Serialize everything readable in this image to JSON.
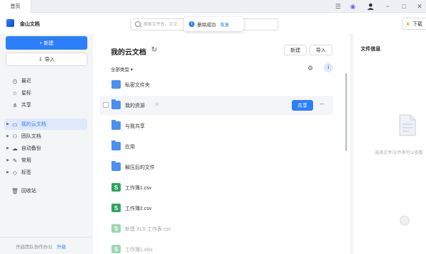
{
  "titlebar": {
    "home_tab": "首页"
  },
  "header": {
    "app_name": "金山文档",
    "search_placeholder": "搜索文件名、正文",
    "toast_text": "删除成功",
    "toast_action": "恢复",
    "right_button_label": "下载"
  },
  "sidebar": {
    "new_label": "+ 新建",
    "import_label": "导入",
    "items": [
      {
        "label": "最近",
        "icon": "clock-icon"
      },
      {
        "label": "星标",
        "icon": "star-icon"
      },
      {
        "label": "共享",
        "icon": "share-icon"
      },
      {
        "label": "我的云文档",
        "icon": "folder-icon"
      },
      {
        "label": "团队文档",
        "icon": "team-icon"
      },
      {
        "label": "自动备份",
        "icon": "backup-icon"
      },
      {
        "label": "常用",
        "icon": "pin-icon"
      },
      {
        "label": "标签",
        "icon": "tag-icon"
      },
      {
        "label": "回收站",
        "icon": "trash-icon"
      }
    ],
    "footer_text": "开启团队协作办公",
    "footer_link": "升级"
  },
  "main": {
    "title": "我的云文档",
    "new_button": "新建",
    "import_button": "导入",
    "filter_label": "全部类型",
    "share_button": "共享",
    "files": [
      {
        "name": "私密文件夹",
        "type": "folder-lock"
      },
      {
        "name": "我的资源",
        "type": "folder"
      },
      {
        "name": "与我共享",
        "type": "folder"
      },
      {
        "name": "应用",
        "type": "folder"
      },
      {
        "name": "解压后的文件",
        "type": "folder"
      },
      {
        "name": "工作簿1.csv",
        "type": "sheet"
      },
      {
        "name": "工作簿2.csv",
        "type": "sheet"
      },
      {
        "name": "新建 XLS 工作表.csv",
        "type": "sheet"
      },
      {
        "name": "工作簿1.xlsx",
        "type": "sheet"
      }
    ]
  },
  "right_panel": {
    "title": "文件信息",
    "empty_text": "选择文件/文件夹可以查看"
  }
}
